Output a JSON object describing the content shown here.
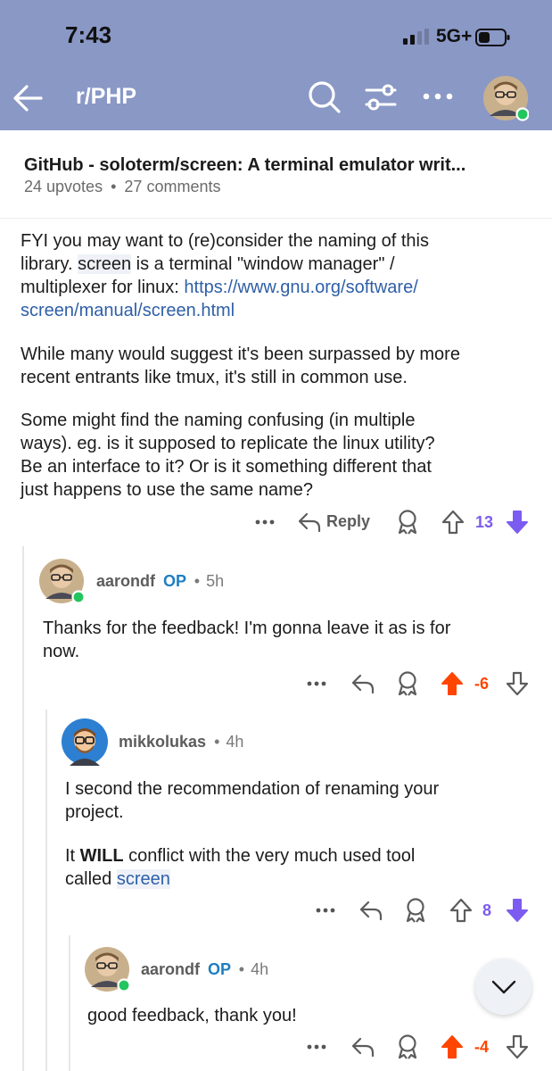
{
  "status_bar": {
    "time": "7:43",
    "network": "5G+"
  },
  "nav": {
    "subreddit": "r/PHP"
  },
  "post": {
    "title": "GitHub - soloterm/screen: A terminal emulator writ...",
    "upvotes": "24 upvotes",
    "separator": "•",
    "comments": "27 comments"
  },
  "comment_root": {
    "p1_a": "FYI you may want to (re)consider the naming of this",
    "p1_b_pre": "library. ",
    "p1_b_code": "screen",
    "p1_b_post": " is a terminal \"window manager\" /",
    "p1_c_pre": "multiplexer for linux: ",
    "p1_c_link": "https://www.gnu.org/software/",
    "p1_d_link": "screen/manual/screen.html",
    "p2_a": "While many would suggest it's been surpassed by more",
    "p2_b": "recent entrants like tmux, it's still in common use.",
    "p3_a": "Some might find the naming confusing (in multiple",
    "p3_b": "ways). eg. is it supposed to replicate the linux utility?",
    "p3_c": "Be an interface to it? Or is it something different that",
    "p3_d": "just happens to use the same name?",
    "reply_label": "Reply",
    "score": "13",
    "more": "•••"
  },
  "comment_2": {
    "author": "aarondf",
    "op": "OP",
    "dot": "•",
    "age": "5h",
    "line1": "Thanks for the feedback! I'm gonna leave it as is for",
    "line2": "now.",
    "score": "-6",
    "more": "•••"
  },
  "comment_3": {
    "author": "mikkolukas",
    "dot": "•",
    "age": "4h",
    "line1": "I second the recommendation of renaming your",
    "line2": "project.",
    "line3_pre": "It ",
    "line3_bold": "WILL",
    "line3_post": " conflict with the very much used tool",
    "line4_pre": "called ",
    "line4_code": "screen",
    "score": "8",
    "more": "•••"
  },
  "comment_4": {
    "author": "aarondf",
    "op": "OP",
    "dot": "•",
    "age": "4h",
    "line1": "good feedback, thank you!",
    "score": "-4",
    "more": "•••"
  },
  "colors": {
    "header": "#8a98c6",
    "upvote_active": "#ff4500",
    "downvote_active": "#7c5cf0",
    "op": "#1e7ec2",
    "link": "#2f5fa7"
  }
}
